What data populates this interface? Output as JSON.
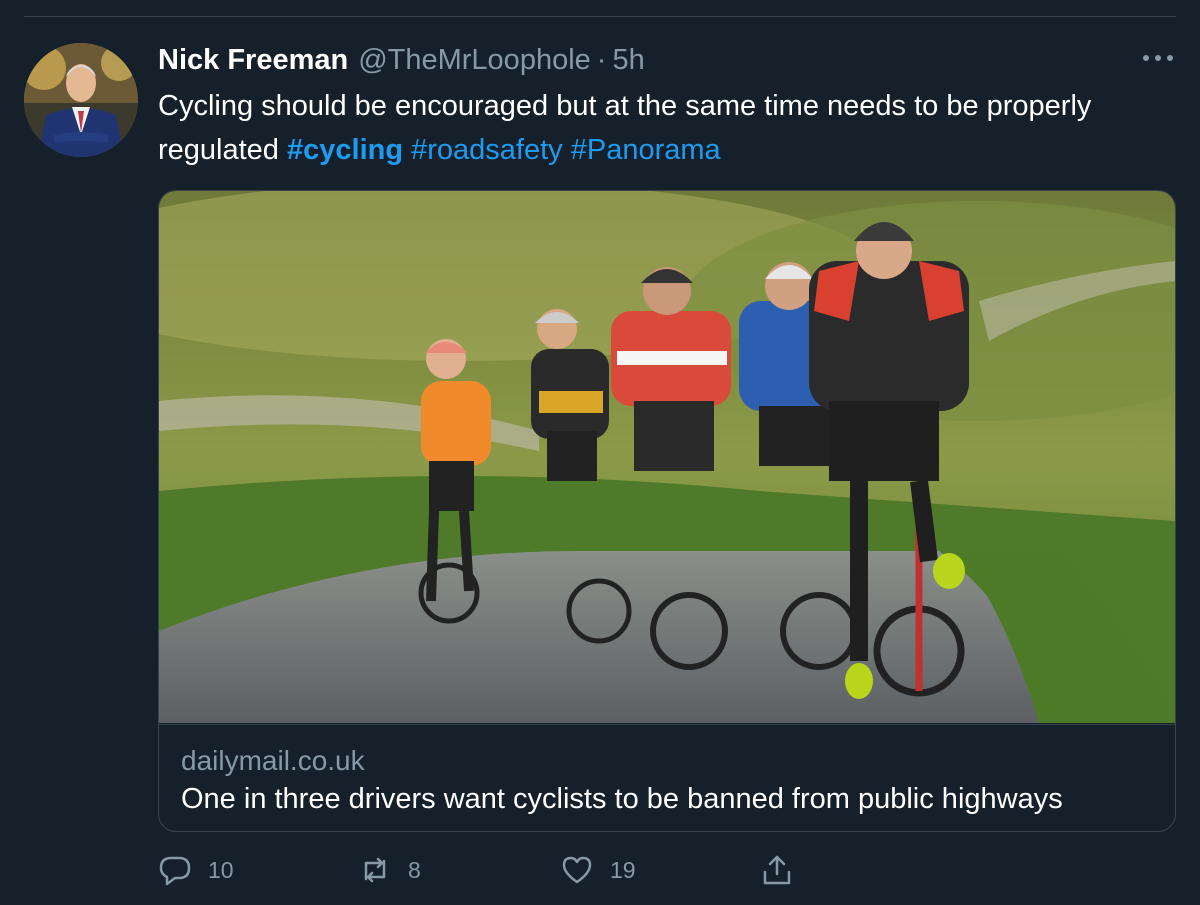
{
  "tweet": {
    "author_name": "Nick Freeman",
    "author_handle": "@TheMrLoophole",
    "separator": "·",
    "time": "5h",
    "text_plain_1": "Cycling should be encouraged but at the same time needs to be properly regulated ",
    "hashtags": [
      "#cycling",
      "#roadsafety",
      "#Panorama"
    ]
  },
  "card": {
    "domain": "dailymail.co.uk",
    "title": "One in three drivers want cyclists to be banned from public highways"
  },
  "actions": {
    "reply_count": "10",
    "retweet_count": "8",
    "like_count": "19"
  },
  "icons": {
    "more": "more-horizontal-icon",
    "reply": "reply-bubble-icon",
    "retweet": "retweet-icon",
    "like": "heart-icon",
    "share": "share-icon"
  },
  "colors": {
    "background": "#15202b",
    "accent": "#1d9bf0",
    "muted": "#8899a6",
    "border": "#38444d"
  }
}
